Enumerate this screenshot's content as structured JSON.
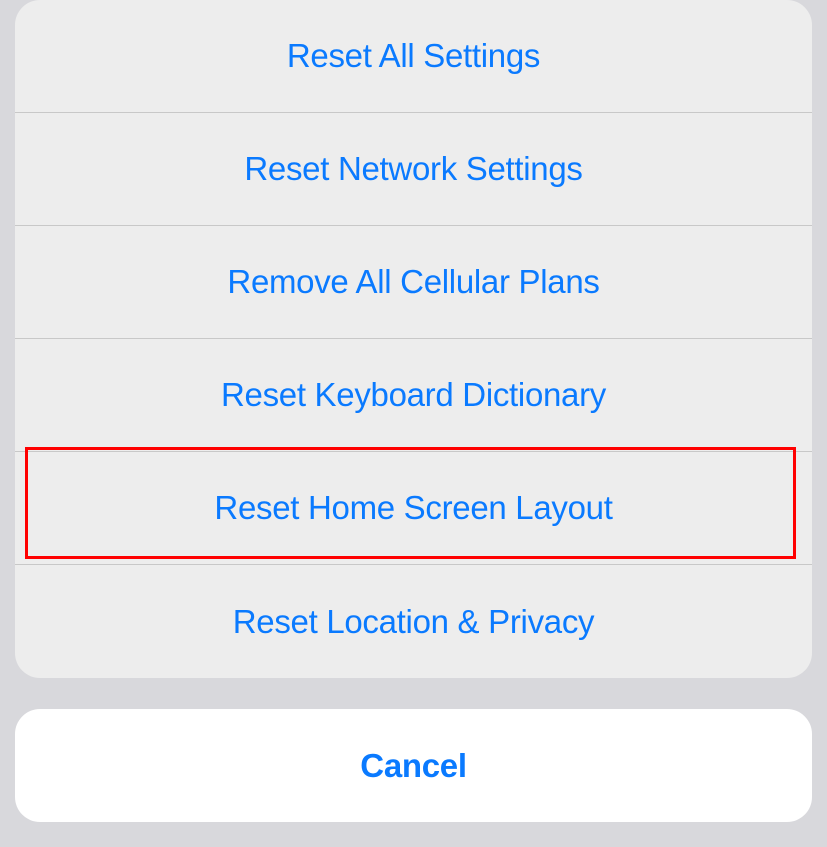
{
  "actionSheet": {
    "options": [
      {
        "label": "Reset All Settings"
      },
      {
        "label": "Reset Network Settings"
      },
      {
        "label": "Remove All Cellular Plans"
      },
      {
        "label": "Reset Keyboard Dictionary"
      },
      {
        "label": "Reset Home Screen Layout",
        "highlighted": true
      },
      {
        "label": "Reset Location & Privacy"
      }
    ],
    "cancelLabel": "Cancel"
  }
}
